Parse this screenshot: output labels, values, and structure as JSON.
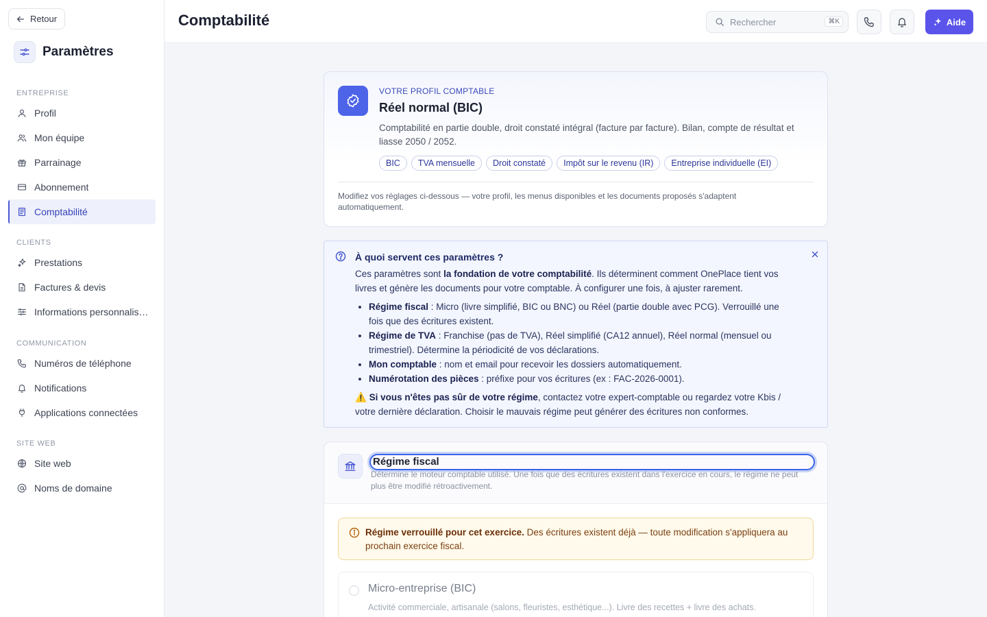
{
  "sidebar": {
    "back_label": "Retour",
    "title": "Paramètres",
    "sections": [
      {
        "title": "ENTREPRISE",
        "items": [
          {
            "label": "Profil",
            "icon": "user-icon"
          },
          {
            "label": "Mon équipe",
            "icon": "team-icon"
          },
          {
            "label": "Parrainage",
            "icon": "gift-icon"
          },
          {
            "label": "Abonnement",
            "icon": "card-icon"
          },
          {
            "label": "Comptabilité",
            "icon": "ledger-icon",
            "active": true
          }
        ]
      },
      {
        "title": "CLIENTS",
        "items": [
          {
            "label": "Prestations",
            "icon": "sparkle-icon"
          },
          {
            "label": "Factures & devis",
            "icon": "document-icon"
          },
          {
            "label": "Informations personnalis…",
            "icon": "sliders-icon"
          }
        ]
      },
      {
        "title": "COMMUNICATION",
        "items": [
          {
            "label": "Numéros de téléphone",
            "icon": "phone-icon"
          },
          {
            "label": "Notifications",
            "icon": "bell-icon"
          },
          {
            "label": "Applications connectées",
            "icon": "plug-icon"
          }
        ]
      },
      {
        "title": "SITE WEB",
        "items": [
          {
            "label": "Site web",
            "icon": "globe-icon"
          },
          {
            "label": "Noms de domaine",
            "icon": "at-icon"
          }
        ]
      }
    ]
  },
  "header": {
    "title": "Comptabilité",
    "search_placeholder": "Rechercher",
    "search_shortcut": "⌘K",
    "help_label": "Aide",
    "accent_color": "#5b54ea"
  },
  "profile": {
    "kicker": "VOTRE PROFIL COMPTABLE",
    "name": "Réel normal (BIC)",
    "description": "Comptabilité en partie double, droit constaté intégral (facture par facture). Bilan, compte de résultat et liasse 2050 / 2052.",
    "tags": [
      "BIC",
      "TVA mensuelle",
      "Droit constaté",
      "Impôt sur le revenu (IR)",
      "Entreprise individuelle (EI)"
    ],
    "note": "Modifiez vos réglages ci-dessous — votre profil, les menus disponibles et les documents proposés s'adaptent automatiquement."
  },
  "info": {
    "title": "À quoi servent ces paramètres ?",
    "intro_1": "Ces paramètres sont ",
    "intro_bold": "la fondation de votre comptabilité",
    "intro_2": ". Ils déterminent comment OnePlace tient vos livres et génère les documents pour votre comptable. À configurer une fois, à ajuster rarement.",
    "bullets": [
      {
        "term": "Régime fiscal",
        "text": " : Micro (livre simplifié, BIC ou BNC) ou Réel (partie double avec PCG). Verrouillé une fois que des écritures existent."
      },
      {
        "term": "Régime de TVA",
        "text": " : Franchise (pas de TVA), Réel simplifié (CA12 annuel), Réel normal (mensuel ou trimestriel). Détermine la périodicité de vos déclarations."
      },
      {
        "term": "Mon comptable",
        "text": " : nom et email pour recevoir les dossiers automatiquement."
      },
      {
        "term": "Numérotation des pièces",
        "text": " : préfixe pour vos écritures (ex : FAC-2026-0001)."
      }
    ],
    "warning_icon": "⚠️",
    "warning_bold": "Si vous n'êtes pas sûr de votre régime",
    "warning_text": ", contactez votre expert-comptable ou regardez votre Kbis / votre dernière déclaration. Choisir le mauvais régime peut générer des écritures non conformes."
  },
  "regime": {
    "title": "Régime fiscal",
    "subtitle": "Détermine le moteur comptable utilisé. Une fois que des écritures existent dans l'exercice en cours, le régime ne peut plus être modifié rétroactivement.",
    "lock_bold": "Régime verrouillé pour cet exercice.",
    "lock_text": " Des écritures existent déjà — toute modification s'appliquera au prochain exercice fiscal.",
    "options": [
      {
        "title": "Micro-entreprise (BIC)",
        "description": "Activité commerciale, artisanale (salons, fleuristes, esthétique...). Livre des recettes + livre des achats."
      }
    ]
  }
}
